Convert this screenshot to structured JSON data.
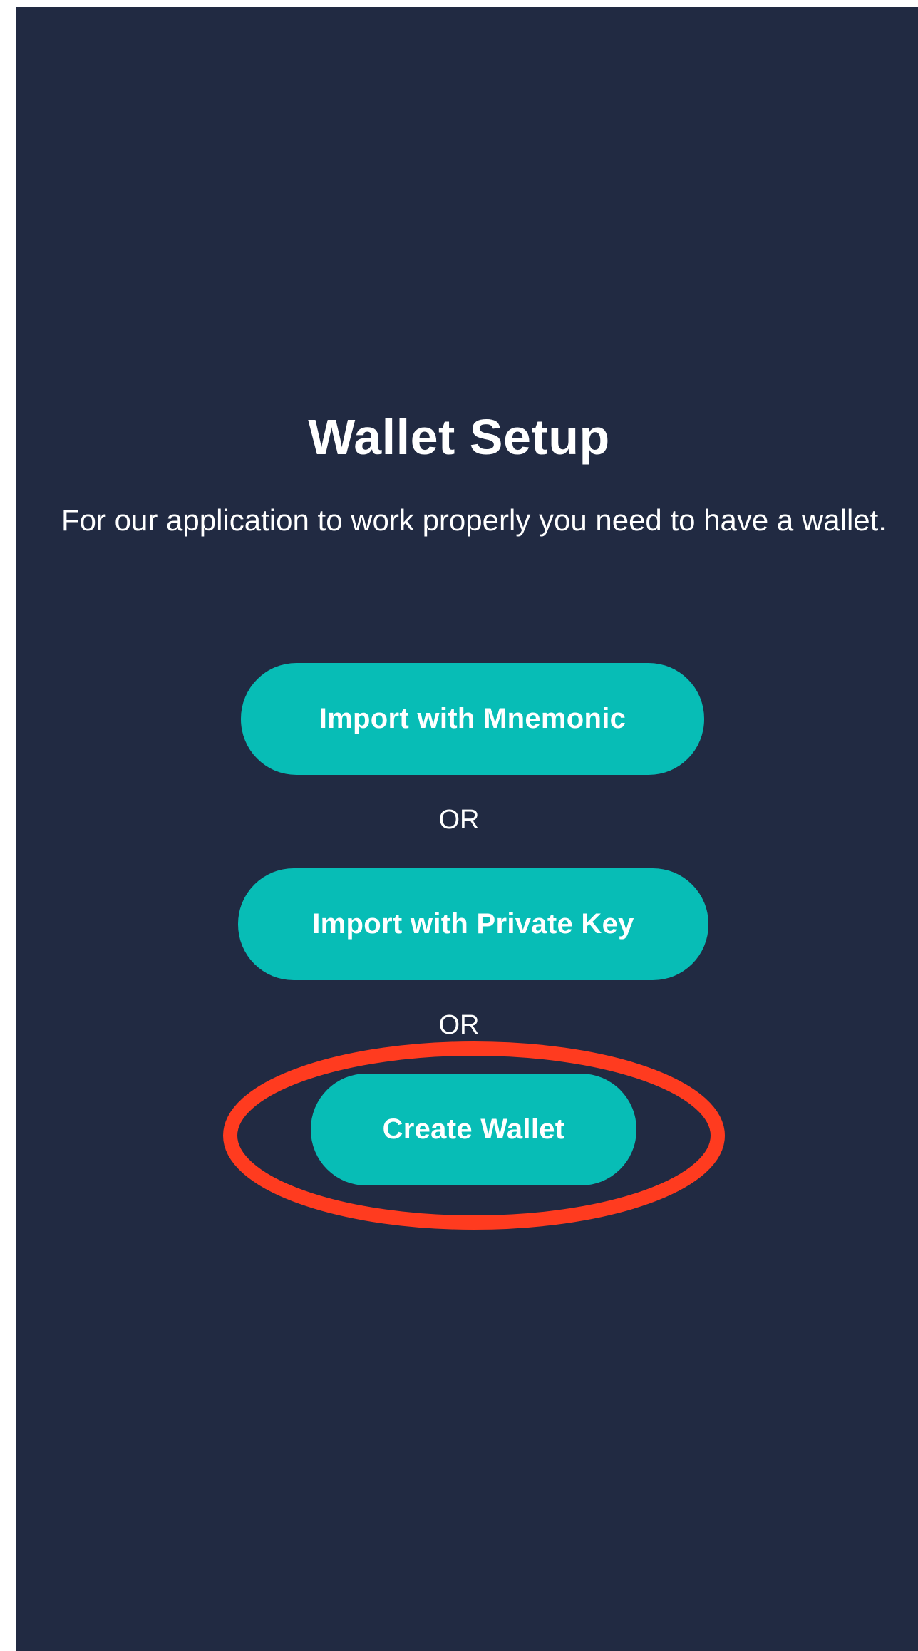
{
  "screen": {
    "title": "Wallet Setup",
    "subtitle": "For our application to work properly you need to have a wallet.",
    "buttons": {
      "import_mnemonic": "Import with Mnemonic",
      "import_private_key": "Import with Private Key",
      "create_wallet": "Create Wallet"
    },
    "separators": [
      "OR",
      "OR"
    ]
  },
  "colors": {
    "background": "#212a42",
    "button": "#07bdb6",
    "button_text": "#ffffff",
    "highlight": "#ff3b1f"
  }
}
